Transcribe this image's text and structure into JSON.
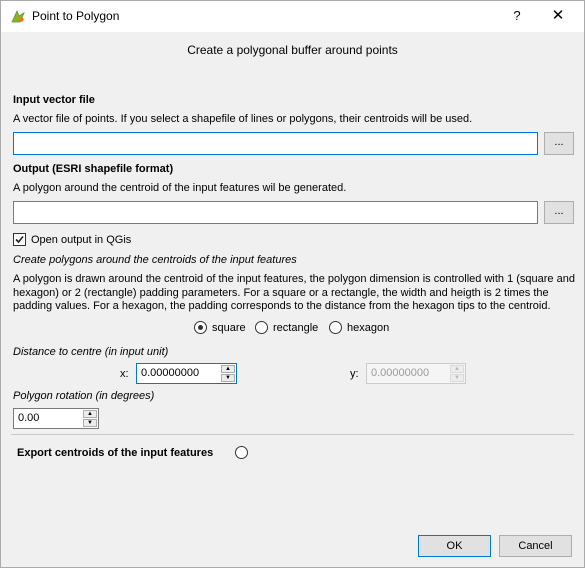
{
  "window": {
    "title": "Point to Polygon",
    "help_label": "?",
    "close_label": "✕"
  },
  "header": "Create a polygonal buffer around points",
  "input": {
    "label": "Input vector file",
    "description": "A vector file of points. If you select a shapefile of lines or polygons, their centroids will be used.",
    "value": "",
    "browse_label": "..."
  },
  "output": {
    "label": "Output (ESRI shapefile format)",
    "description": "A polygon around the centroid of the input features wil be generated.",
    "value": "",
    "browse_label": "...",
    "open_output_label": "Open output  in QGis",
    "open_output_checked": true
  },
  "polygons": {
    "section_label": "Create polygons around the centroids of the input features",
    "description": "A polygon is drawn around the centroid of the input features, the polygon dimension is controlled with 1 (square and hexagon) or 2 (rectangle) padding parameters. For a square or a rectangle, the width and heigth is 2 times the padding values. For a hexagon, the padding corresponds to the distance from the hexagon tips to the centroid.",
    "shape_options": [
      "square",
      "rectangle",
      "hexagon"
    ],
    "selected_shape": "square"
  },
  "distance": {
    "label": "Distance to centre (in input unit)",
    "x_label": "x:",
    "x_value": "0.00000000",
    "y_label": "y:",
    "y_value": "0.00000000",
    "y_enabled": false
  },
  "rotation": {
    "label": "Polygon rotation (in degrees)",
    "value": "0.00"
  },
  "export": {
    "label": "Export centroids of the input features",
    "checked": false
  },
  "buttons": {
    "ok": "OK",
    "cancel": "Cancel"
  },
  "colors": {
    "focus_border": "#0078d7",
    "button_face": "#e1e1e1",
    "dialog_bg": "#f0f0f0"
  }
}
